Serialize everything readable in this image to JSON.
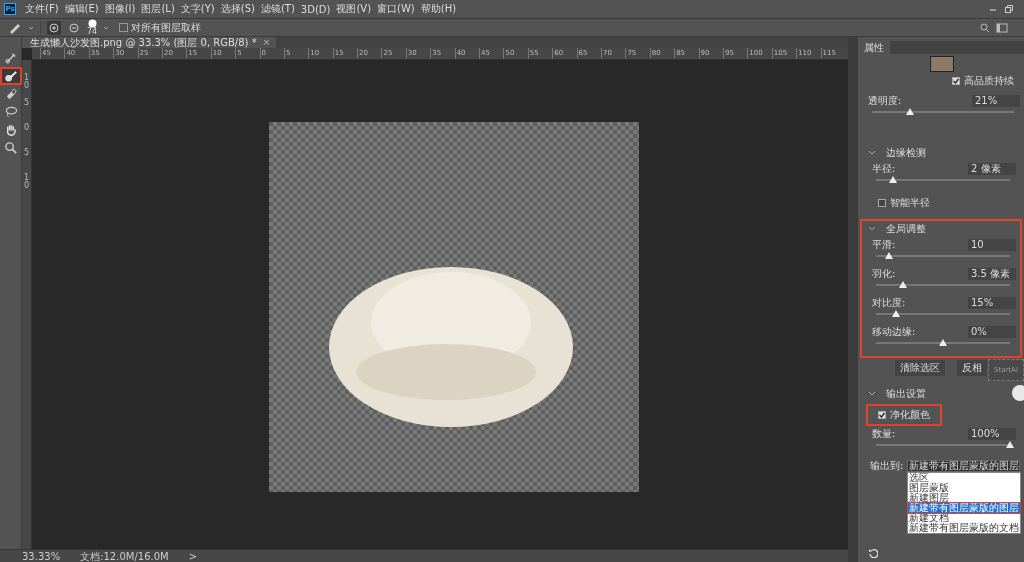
{
  "menu": {
    "app_logo": "Ps",
    "items": [
      "文件(F)",
      "编辑(E)",
      "图像(I)",
      "图层(L)",
      "文字(Y)",
      "选择(S)",
      "滤镜(T)",
      "3D(D)",
      "视图(V)",
      "窗口(W)",
      "帮助(H)"
    ]
  },
  "options_bar": {
    "modes": [
      {
        "kind": "add",
        "selected": true
      },
      {
        "kind": "subtract",
        "selected": false
      }
    ],
    "brush_size": "74",
    "sample_all_layers": {
      "label": "对所有图层取样",
      "checked": false
    }
  },
  "tools": [
    {
      "kind": "brush",
      "selected": false,
      "highlighted": false
    },
    {
      "kind": "refine-brush",
      "selected": true,
      "highlighted": true
    },
    {
      "kind": "eraser",
      "selected": false,
      "highlighted": false
    },
    {
      "kind": "lasso",
      "selected": false,
      "highlighted": false
    },
    {
      "kind": "hand",
      "selected": false,
      "highlighted": false
    },
    {
      "kind": "zoom",
      "selected": false,
      "highlighted": false
    }
  ],
  "document": {
    "tab_title": "生成懒人沙发图.png @ 33.3% (图层 0, RGB/8) *",
    "close": "×",
    "ruler_labels": [
      "45",
      "40",
      "35",
      "30",
      "25",
      "20",
      "15",
      "10",
      "5",
      "0",
      "5",
      "10",
      "15",
      "20",
      "25",
      "30",
      "35",
      "40",
      "45",
      "50",
      "55",
      "60",
      "65",
      "70",
      "75",
      "80",
      "85",
      "90",
      "95",
      "100",
      "105",
      "110",
      "115"
    ],
    "vertical_ruler_labels": [
      "10",
      "5",
      "0",
      "5",
      "10"
    ]
  },
  "properties": {
    "tab": "属性",
    "high_quality": {
      "label": "高品质持续",
      "checked": true
    },
    "opacity": {
      "label": "透明度:",
      "value": "21%",
      "level": 0.27
    },
    "blocks": [
      {
        "kind": "section",
        "title": "边缘检测",
        "expanded": true,
        "highlighted": false,
        "rows": [
          {
            "kind": "slider",
            "label": "半径:",
            "value": "2 像素",
            "level": 0.13
          },
          {
            "kind": "checkbox",
            "label": "智能半径",
            "checked": false
          }
        ]
      },
      {
        "kind": "section",
        "title": "全局调整",
        "expanded": true,
        "highlighted": true,
        "rows": [
          {
            "kind": "slider",
            "label": "平滑:",
            "value": "10",
            "level": 0.1
          },
          {
            "kind": "slider",
            "label": "羽化:",
            "value": "3.5 像素",
            "level": 0.2
          },
          {
            "kind": "slider",
            "label": "对比度:",
            "value": "15%",
            "level": 0.15
          },
          {
            "kind": "slider",
            "label": "移动边缘:",
            "value": "0%",
            "level": 0.5
          }
        ]
      },
      {
        "kind": "buttons",
        "labels": [
          "清除选区",
          "反相"
        ]
      },
      {
        "kind": "section",
        "title": "输出设置",
        "expanded": true,
        "highlighted": false,
        "rows": [
          {
            "kind": "checkbox",
            "label": "净化颜色",
            "checked": true,
            "highlighted": true
          },
          {
            "kind": "slider",
            "label": "数量:",
            "value": "100%",
            "level": 1
          },
          {
            "kind": "select",
            "label": "输出到:",
            "value": "新建带有图层蒙版的图层",
            "open": true,
            "options": [
              {
                "label": "选区",
                "selected": false,
                "highlighted": false
              },
              {
                "label": "图层蒙版",
                "selected": false,
                "highlighted": false
              },
              {
                "label": "新建图层",
                "selected": false,
                "highlighted": false
              },
              {
                "label": "新建带有图层蒙版的图层",
                "selected": true,
                "highlighted": true
              },
              {
                "label": "新建文档",
                "selected": false,
                "highlighted": false
              },
              {
                "label": "新建带有图层蒙版的文档",
                "selected": false,
                "highlighted": false
              }
            ]
          }
        ]
      }
    ]
  },
  "startai_widget": {
    "label": "StartAI"
  },
  "status_bar": {
    "zoom": "33.33%",
    "doc_size": "文档:12.0M/16.0M",
    "arrow": ">"
  }
}
